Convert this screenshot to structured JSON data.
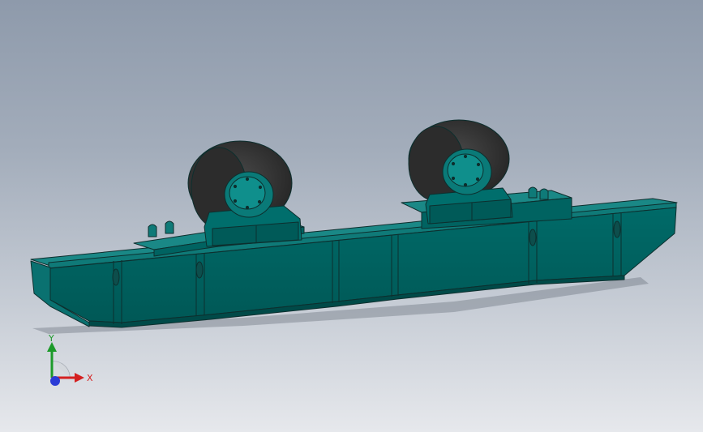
{
  "viewport": {
    "background_top": "#8e9aab",
    "background_bottom": "#e6e8ec"
  },
  "model": {
    "body_color": "#00605e",
    "edge_color": "#0d2f2e",
    "tyre_color": "#333333",
    "rollers": 2
  },
  "triad": {
    "x_label": "X",
    "y_label": "Y",
    "x_color": "#d42020",
    "y_color": "#1c9a2a",
    "z_color": "#2a3bd6"
  }
}
